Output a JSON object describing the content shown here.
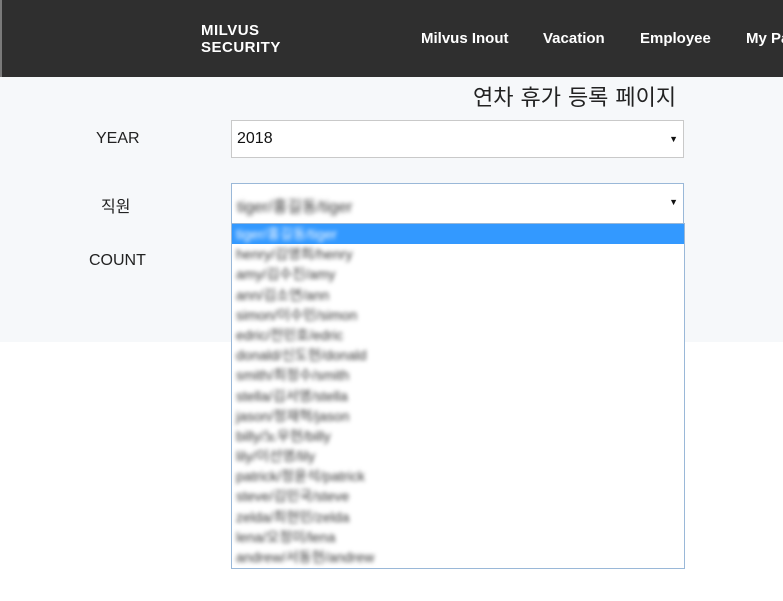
{
  "header": {
    "brand_line1": "MILVUS",
    "brand_line2": "SECURITY",
    "nav": [
      {
        "label": "Milvus Inout"
      },
      {
        "label": "Vacation"
      },
      {
        "label": "Employee"
      },
      {
        "label": "My Pa"
      }
    ]
  },
  "page": {
    "title": "연차 휴가 등록 페이지"
  },
  "form": {
    "year_label": "YEAR",
    "year_value": "2018",
    "employee_label": "직원",
    "employee_value": "tiger/홍길동/tiger",
    "count_label": "COUNT"
  },
  "dropdown": {
    "options": [
      "tiger/홍길동/tiger",
      "henry/김영희/henry",
      "amy/김수진/amy",
      "ann/김소연/ann",
      "simon/이수민/simon",
      "edric/전민호/edric",
      "donald/신도현/donald",
      "smith/최정수/smith",
      "stella/김서영/stella",
      "jason/정재혁/jason",
      "billy/노우현/billy",
      "lily/이선영/lily",
      "patrick/정윤석/patrick",
      "steve/김민국/steve",
      "zelda/최현민/zelda",
      "lena/오정미/lena",
      "andrew/서동현/andrew"
    ]
  },
  "colors": {
    "header_bg": "#2f2f2f",
    "content_bg": "#f6f8fa",
    "selected_option_bg": "#3399ff",
    "focus_border": "#9ab8d8"
  }
}
